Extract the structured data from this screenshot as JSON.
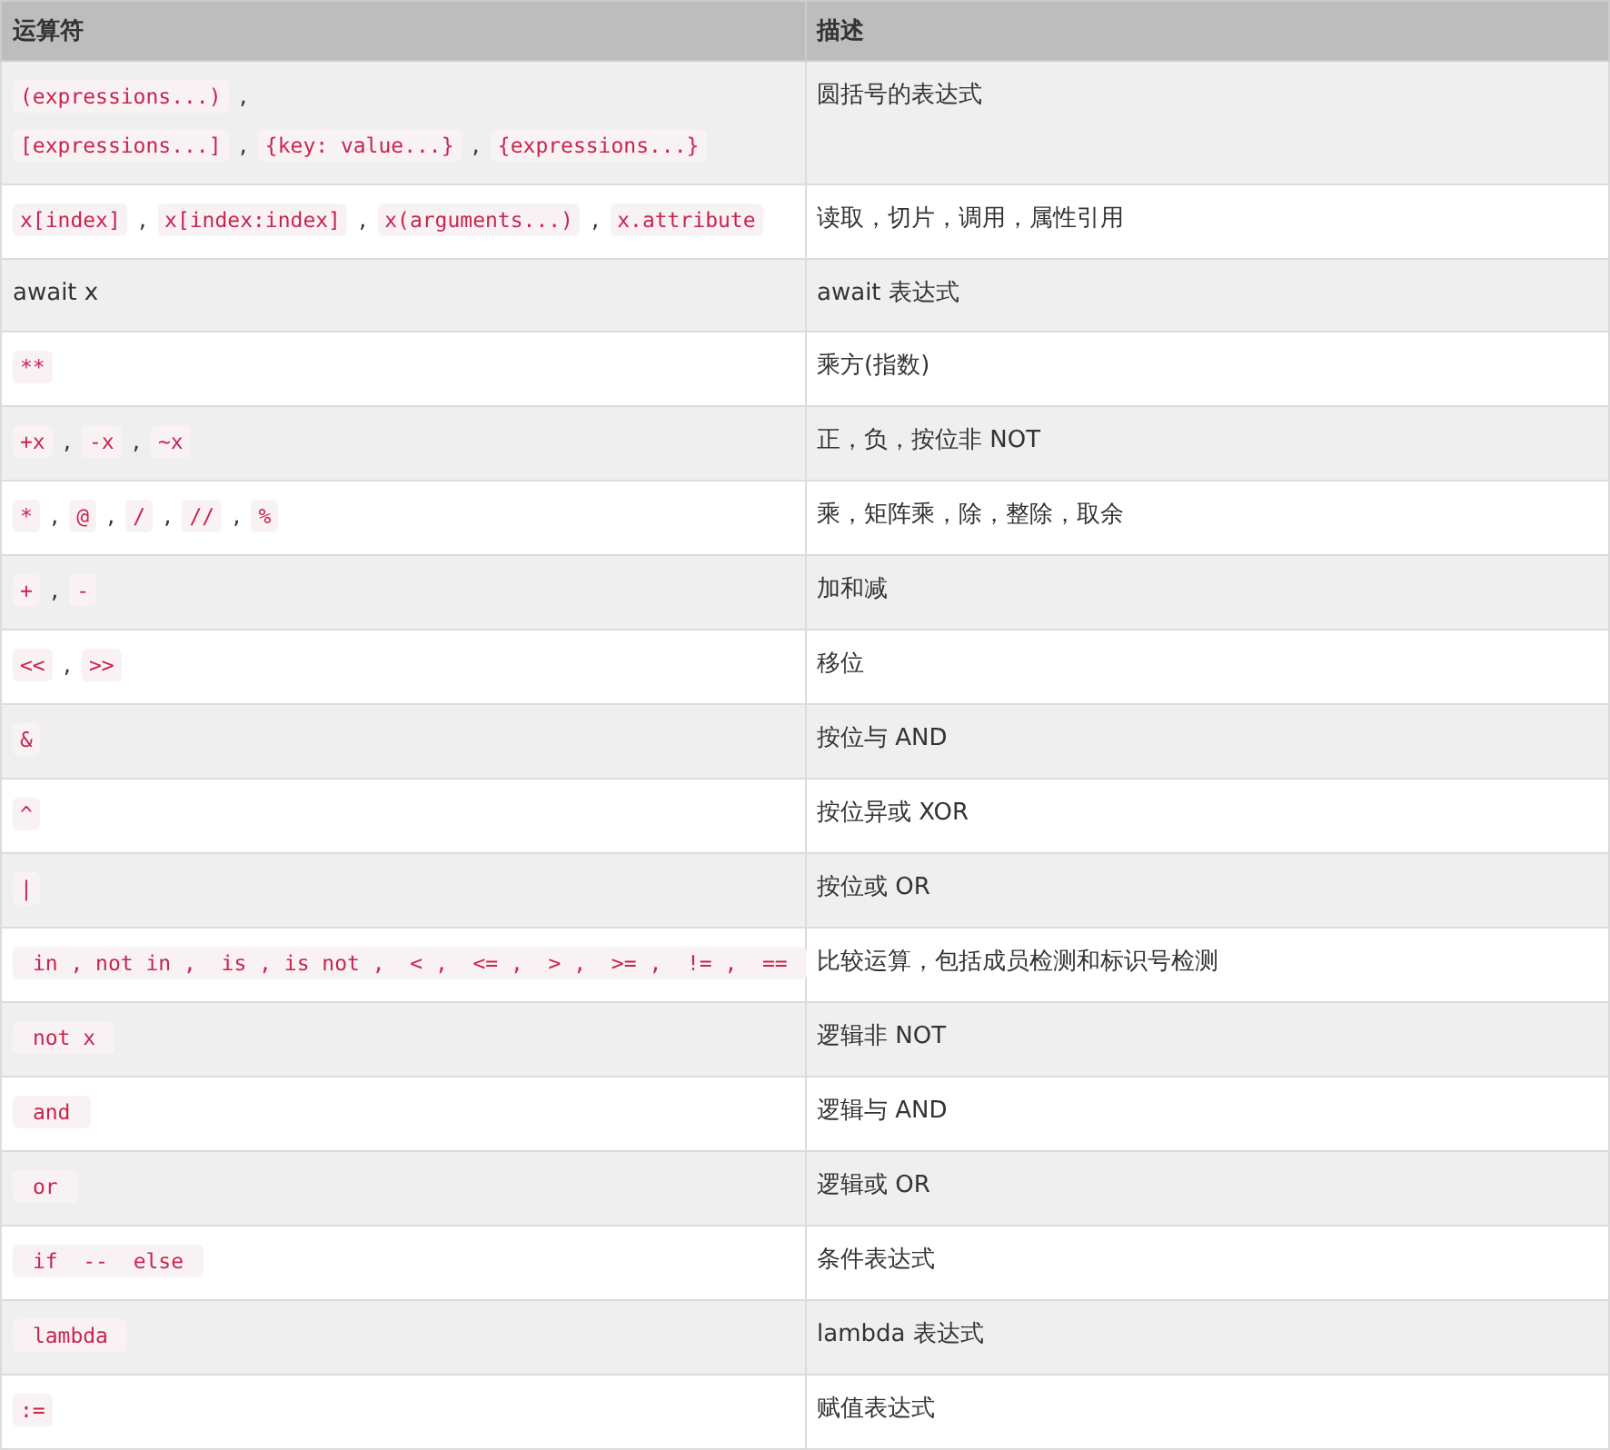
{
  "table": {
    "columns": [
      "运算符",
      "描述"
    ],
    "rows": [
      {
        "operator": [
          {
            "kind": "code",
            "text": "(expressions...)"
          },
          {
            "kind": "text",
            "text": ","
          },
          {
            "kind": "break"
          },
          {
            "kind": "code",
            "text": "[expressions...]"
          },
          {
            "kind": "text",
            "text": ","
          },
          {
            "kind": "code",
            "text": "{key: value...}"
          },
          {
            "kind": "text",
            "text": ","
          },
          {
            "kind": "code",
            "text": "{expressions...}"
          }
        ],
        "description": "圆括号的表达式"
      },
      {
        "operator": [
          {
            "kind": "code",
            "text": "x[index]"
          },
          {
            "kind": "text",
            "text": ","
          },
          {
            "kind": "code",
            "text": "x[index:index]"
          },
          {
            "kind": "text",
            "text": ","
          },
          {
            "kind": "code",
            "text": "x(arguments...)"
          },
          {
            "kind": "text",
            "text": ","
          },
          {
            "kind": "code",
            "text": "x.attribute"
          }
        ],
        "description": "读取，切片，调用，属性引用"
      },
      {
        "operator": [
          {
            "kind": "text",
            "text": "await x"
          }
        ],
        "description": "await 表达式"
      },
      {
        "operator": [
          {
            "kind": "code",
            "text": "**"
          }
        ],
        "description": "乘方(指数)"
      },
      {
        "operator": [
          {
            "kind": "code",
            "text": "+x"
          },
          {
            "kind": "text",
            "text": ","
          },
          {
            "kind": "code",
            "text": "-x"
          },
          {
            "kind": "text",
            "text": ","
          },
          {
            "kind": "code",
            "text": "~x"
          }
        ],
        "description": "正，负，按位非 NOT"
      },
      {
        "operator": [
          {
            "kind": "code",
            "text": "*"
          },
          {
            "kind": "text",
            "text": ","
          },
          {
            "kind": "code",
            "text": "@"
          },
          {
            "kind": "text",
            "text": ","
          },
          {
            "kind": "code",
            "text": "/"
          },
          {
            "kind": "text",
            "text": ","
          },
          {
            "kind": "code",
            "text": "//"
          },
          {
            "kind": "text",
            "text": ","
          },
          {
            "kind": "code",
            "text": "%"
          }
        ],
        "description": "乘，矩阵乘，除，整除，取余"
      },
      {
        "operator": [
          {
            "kind": "code",
            "text": "+"
          },
          {
            "kind": "text",
            "text": ","
          },
          {
            "kind": "code",
            "text": "-"
          }
        ],
        "description": "加和减"
      },
      {
        "operator": [
          {
            "kind": "code",
            "text": "<<"
          },
          {
            "kind": "text",
            "text": ","
          },
          {
            "kind": "code",
            "text": ">>"
          }
        ],
        "description": "移位"
      },
      {
        "operator": [
          {
            "kind": "code",
            "text": "&"
          }
        ],
        "description": "按位与 AND"
      },
      {
        "operator": [
          {
            "kind": "code",
            "text": "^"
          }
        ],
        "description": "按位异或 XOR"
      },
      {
        "operator": [
          {
            "kind": "code",
            "text": "|"
          }
        ],
        "description": "按位或 OR"
      },
      {
        "operator": [
          {
            "kind": "code",
            "text": " in , not in ,  is , is not ,  < ,  <= ,  > ,  >= ,  != ,  == "
          }
        ],
        "description": "比较运算，包括成员检测和标识号检测"
      },
      {
        "operator": [
          {
            "kind": "code",
            "text": " not x "
          }
        ],
        "description": "逻辑非 NOT"
      },
      {
        "operator": [
          {
            "kind": "code",
            "text": " and "
          }
        ],
        "description": "逻辑与 AND"
      },
      {
        "operator": [
          {
            "kind": "code",
            "text": " or "
          }
        ],
        "description": "逻辑或 OR"
      },
      {
        "operator": [
          {
            "kind": "code",
            "text": " if  --  else "
          }
        ],
        "description": "条件表达式"
      },
      {
        "operator": [
          {
            "kind": "code",
            "text": " lambda "
          }
        ],
        "description": "lambda 表达式"
      },
      {
        "operator": [
          {
            "kind": "code",
            "text": ":="
          }
        ],
        "description": "赋值表达式"
      }
    ]
  }
}
